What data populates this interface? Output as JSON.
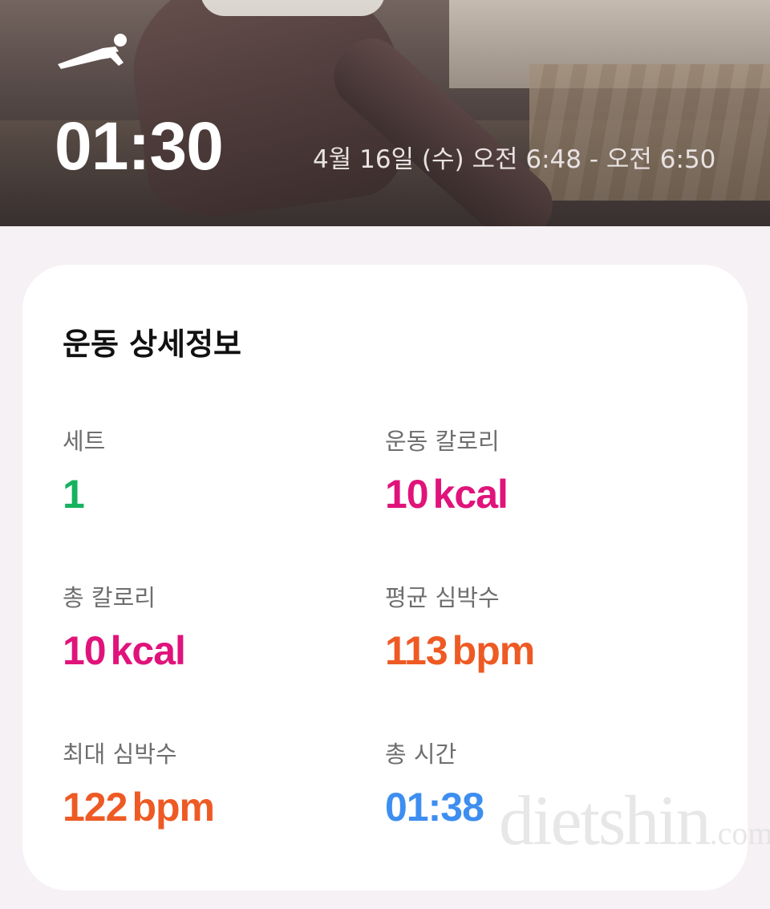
{
  "header": {
    "workout_icon": "stretching-person-icon",
    "duration": "01:30",
    "time_range": "4월 16일 (수) 오전 6:48 - 오전 6:50"
  },
  "details": {
    "title": "운동 상세정보",
    "stats": [
      {
        "label": "세트",
        "value": "1",
        "unit": "",
        "color": "#15b35e"
      },
      {
        "label": "운동 칼로리",
        "value": "10",
        "unit": "kcal",
        "color": "#e0137b"
      },
      {
        "label": "총 칼로리",
        "value": "10",
        "unit": "kcal",
        "color": "#e0137b"
      },
      {
        "label": "평균 심박수",
        "value": "113",
        "unit": "bpm",
        "color": "#ee5a24"
      },
      {
        "label": "최대 심박수",
        "value": "122",
        "unit": "bpm",
        "color": "#ee5a24"
      },
      {
        "label": "총 시간",
        "value": "01:38",
        "unit": "",
        "color": "#3d8ef0"
      }
    ]
  },
  "watermark": {
    "brand": "dietshin",
    "domain": ".com"
  },
  "colors": {
    "page_background": "#f6f1f5",
    "card_background": "#ffffff",
    "sets": "#15b35e",
    "calories": "#e0137b",
    "heart_rate": "#ee5a24",
    "time": "#3d8ef0"
  }
}
